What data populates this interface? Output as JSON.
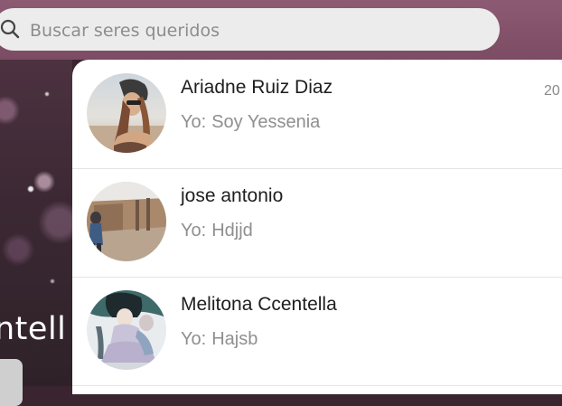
{
  "search": {
    "placeholder": "Buscar seres queridos",
    "value": ""
  },
  "background_profile": {
    "name_fragment": "ntell"
  },
  "conversations": [
    {
      "name": "Ariadne Ruiz Diaz",
      "prefix": "Yo:",
      "message": "Soy Yessenia",
      "time": "20"
    },
    {
      "name": "jose antonio",
      "prefix": "Yo:",
      "message": "Hdjjd",
      "time": ""
    },
    {
      "name": "Melitona Ccentella",
      "prefix": "Yo:",
      "message": "Hajsb",
      "time": ""
    }
  ],
  "colors": {
    "header": "#8d5a73",
    "search_background": "#ececec",
    "name_text": "#1e1e1e",
    "preview_text": "#8f8f8f"
  },
  "icons": {
    "search": "search-icon"
  }
}
